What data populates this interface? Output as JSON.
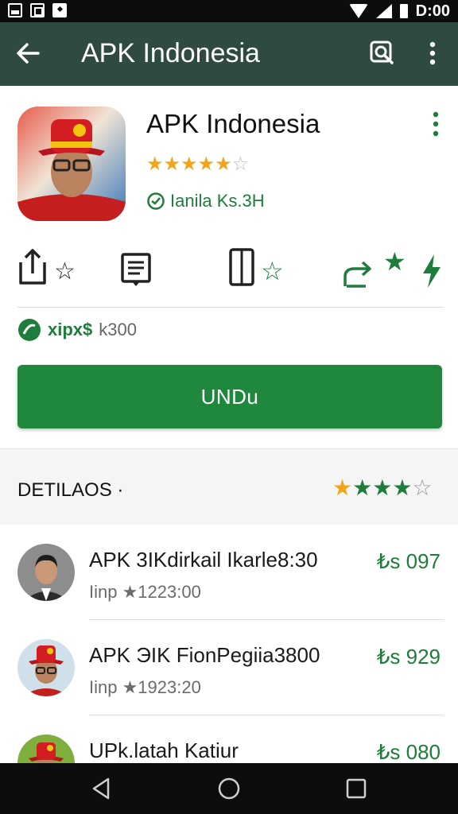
{
  "status_bar": {
    "time": "D:00"
  },
  "toolbar": {
    "title": "APK Indonesia"
  },
  "app": {
    "name": "APK Indonesia",
    "rating_stars": 4.5,
    "verified_text": "Ianila Ks.3H",
    "secondary_line": {
      "highlight": "xipx$",
      "text": "k300"
    },
    "install_label": "UNDu"
  },
  "section": {
    "title": "DETILAOS ·",
    "rating_stars": 4
  },
  "list": [
    {
      "title": "APK 3IKdirkail Ikarle8:30",
      "subtitle": "Iinp ★1223:00",
      "price": "₺s 097"
    },
    {
      "title": "APK ЭIK FionPegiia3800",
      "subtitle": "Iinp ★1923:20",
      "price": "₺s 929"
    },
    {
      "title": "UPk.latah Katiur",
      "subtitle": "",
      "price": "₺s 080"
    }
  ],
  "colors": {
    "toolbar_bg": "#2f4a3f",
    "accent_green": "#1f883d",
    "star_gold": "#f2a51a"
  }
}
